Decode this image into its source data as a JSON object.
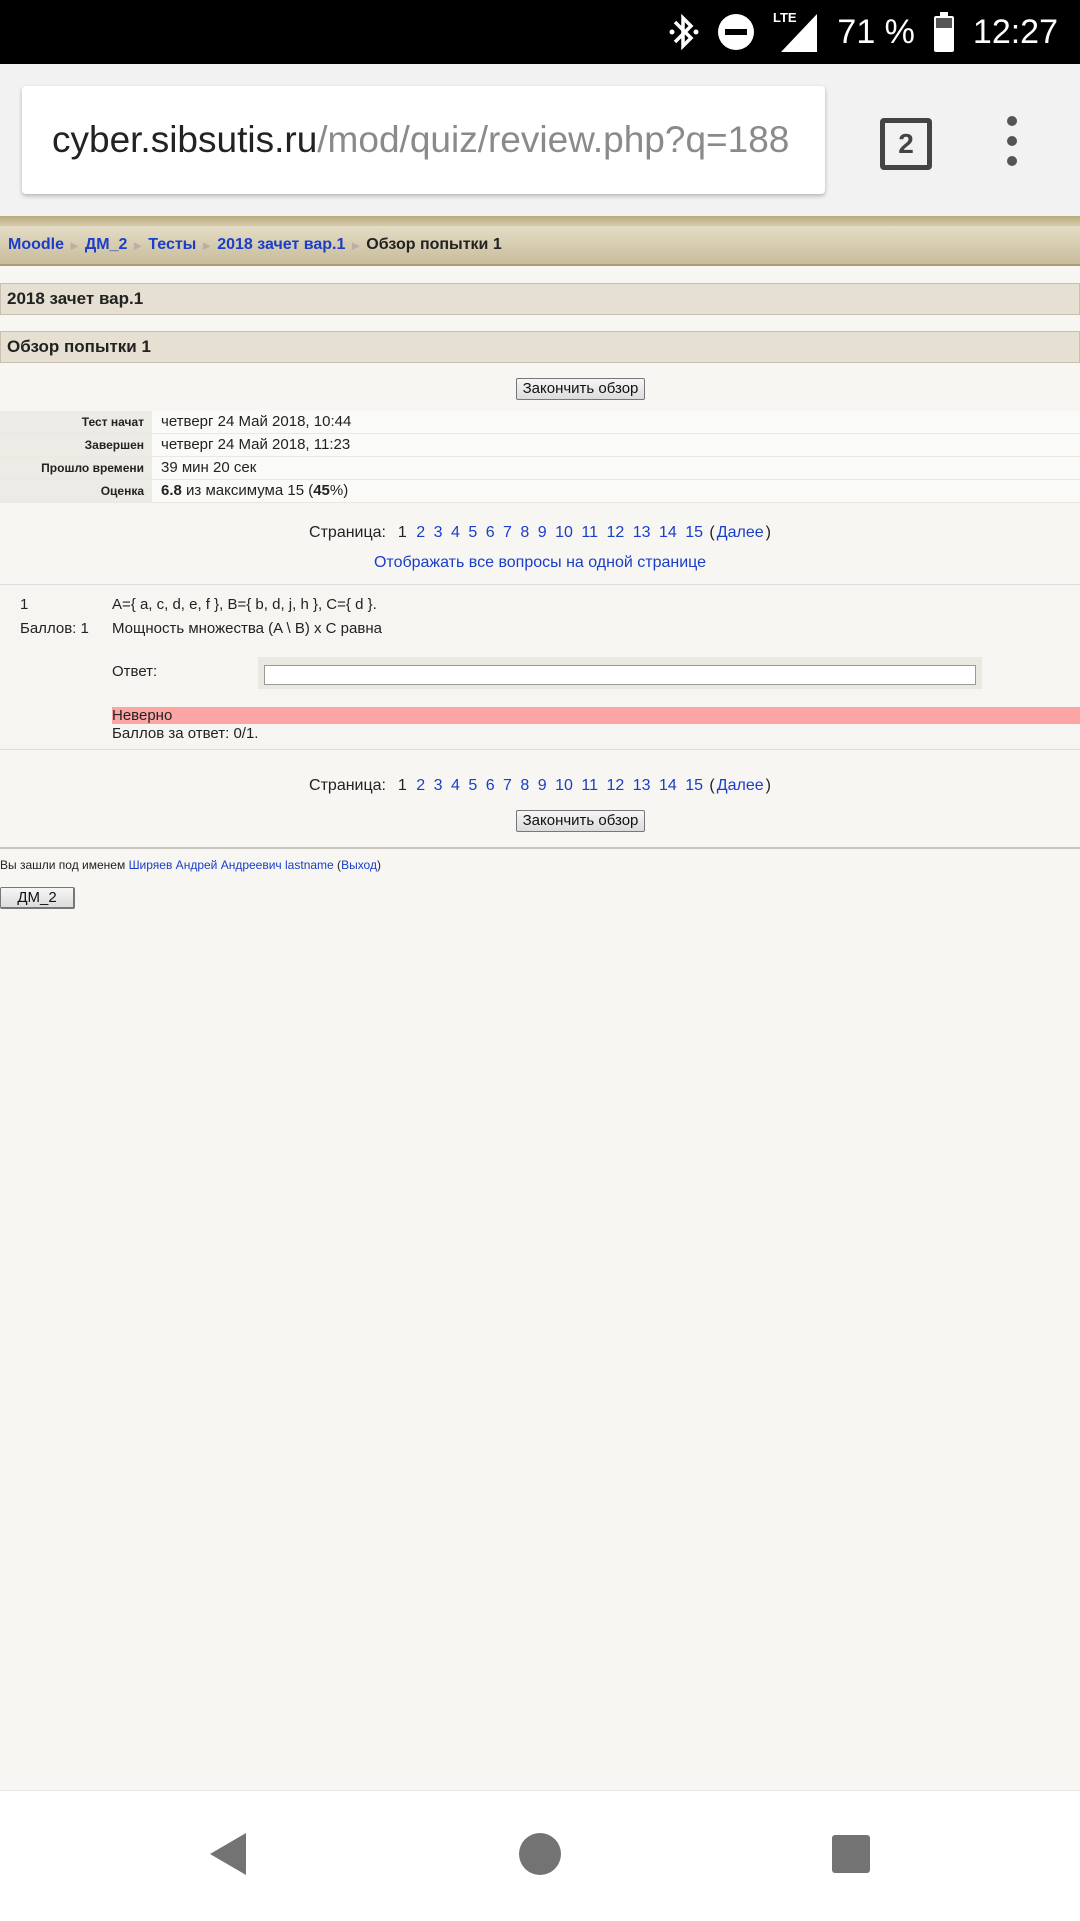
{
  "status_bar": {
    "battery": "71 %",
    "time": "12:27",
    "network": "LTE"
  },
  "browser": {
    "url_host": "cyber.sibsutis.ru",
    "url_path": "/mod/quiz/review.php?q=188",
    "tab_count": "2"
  },
  "breadcrumb": {
    "items": [
      "Moodle",
      "ДМ_2",
      "Тесты",
      "2018 зачет вар.1"
    ],
    "separator": "►",
    "current": "Обзор попытки 1"
  },
  "quiz_title": "2018 зачет вар.1",
  "review_heading": "Обзор попытки 1",
  "finish_review_label": "Закончить обзор",
  "summary": [
    {
      "label": "Тест начат",
      "value": "четверг 24 Май 2018, 10:44"
    },
    {
      "label": "Завершен",
      "value": "четверг 24 Май 2018, 11:23"
    },
    {
      "label": "Прошло времени",
      "value": "39 мин 20 сек"
    }
  ],
  "grade": {
    "label": "Оценка",
    "score": "6.8",
    "text_mid": " из максимума 15 (",
    "percent": "45",
    "text_end": "%)"
  },
  "pager": {
    "label": "Страница:",
    "current": "1",
    "pages": [
      "2",
      "3",
      "4",
      "5",
      "6",
      "7",
      "8",
      "9",
      "10",
      "11",
      "12",
      "13",
      "14",
      "15"
    ],
    "next_label": "Далее"
  },
  "show_all_label": "Отображать все вопросы на одной странице",
  "question": {
    "number": "1",
    "points": "Баллов: 1",
    "line1": "A={ a, c, d, e, f }, B={ b, d, j, h }, C={ d }.",
    "line2": "Мощность множества (A \\ B) x C равна",
    "answer_label": "Ответ:",
    "answer_value": "",
    "result": "Неверно",
    "grade": "Баллов за ответ: 0/1."
  },
  "footer": {
    "login_prefix": "Вы зашли под именем ",
    "user": "Ширяев Андрей Андреевич lastname",
    "logout": "Выход",
    "course_button": "ДМ_2"
  },
  "colors": {
    "link": "#1a3ec8",
    "incorrect": "#fca5a5",
    "page_bg": "#f7f6f2"
  }
}
